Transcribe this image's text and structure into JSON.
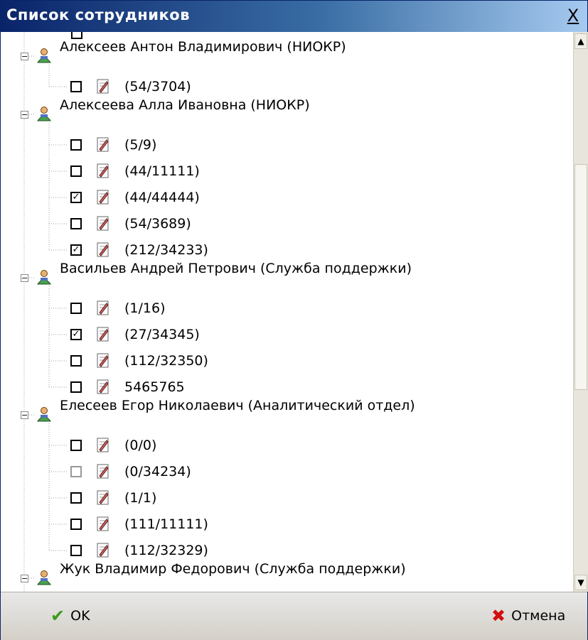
{
  "window": {
    "title": "Список сотрудников",
    "close_label": "X"
  },
  "employees": [
    {
      "name": "Алексеев Антон Владимирович (НИОКР)",
      "items": [
        {
          "label": "(54/3704)",
          "checked": false
        }
      ]
    },
    {
      "name": "Алексеева Алла Ивановна (НИОКР)",
      "items": [
        {
          "label": "(5/9)",
          "checked": false
        },
        {
          "label": "(44/11111)",
          "checked": false
        },
        {
          "label": "(44/44444)",
          "checked": true
        },
        {
          "label": "(54/3689)",
          "checked": false
        },
        {
          "label": "(212/34233)",
          "checked": true
        }
      ]
    },
    {
      "name": "Васильев Андрей Петрович (Служба поддержки)",
      "items": [
        {
          "label": "(1/16)",
          "checked": false
        },
        {
          "label": "(27/34345)",
          "checked": true
        },
        {
          "label": "(112/32350)",
          "checked": false
        },
        {
          "label": "5465765",
          "checked": false
        }
      ]
    },
    {
      "name": "Елесеев Егор Николаевич (Аналитический отдел)",
      "items": [
        {
          "label": "(0/0)",
          "checked": false
        },
        {
          "label": "(0/34234)",
          "checked": false,
          "grey": true
        },
        {
          "label": "(1/1)",
          "checked": false
        },
        {
          "label": "(111/11111)",
          "checked": false
        },
        {
          "label": "(112/32329)",
          "checked": false
        }
      ]
    },
    {
      "name": "Жук Владимир Федорович (Служба поддержки)",
      "items": []
    }
  ],
  "footer": {
    "ok_label": "OK",
    "cancel_label": "Отмена"
  },
  "scrollbar": {
    "up_arrow": "▲",
    "down_arrow": "▼"
  },
  "icons": {
    "person": "person-icon",
    "document": "document-icon",
    "ok": "checkmark-icon",
    "cancel": "cross-icon"
  }
}
